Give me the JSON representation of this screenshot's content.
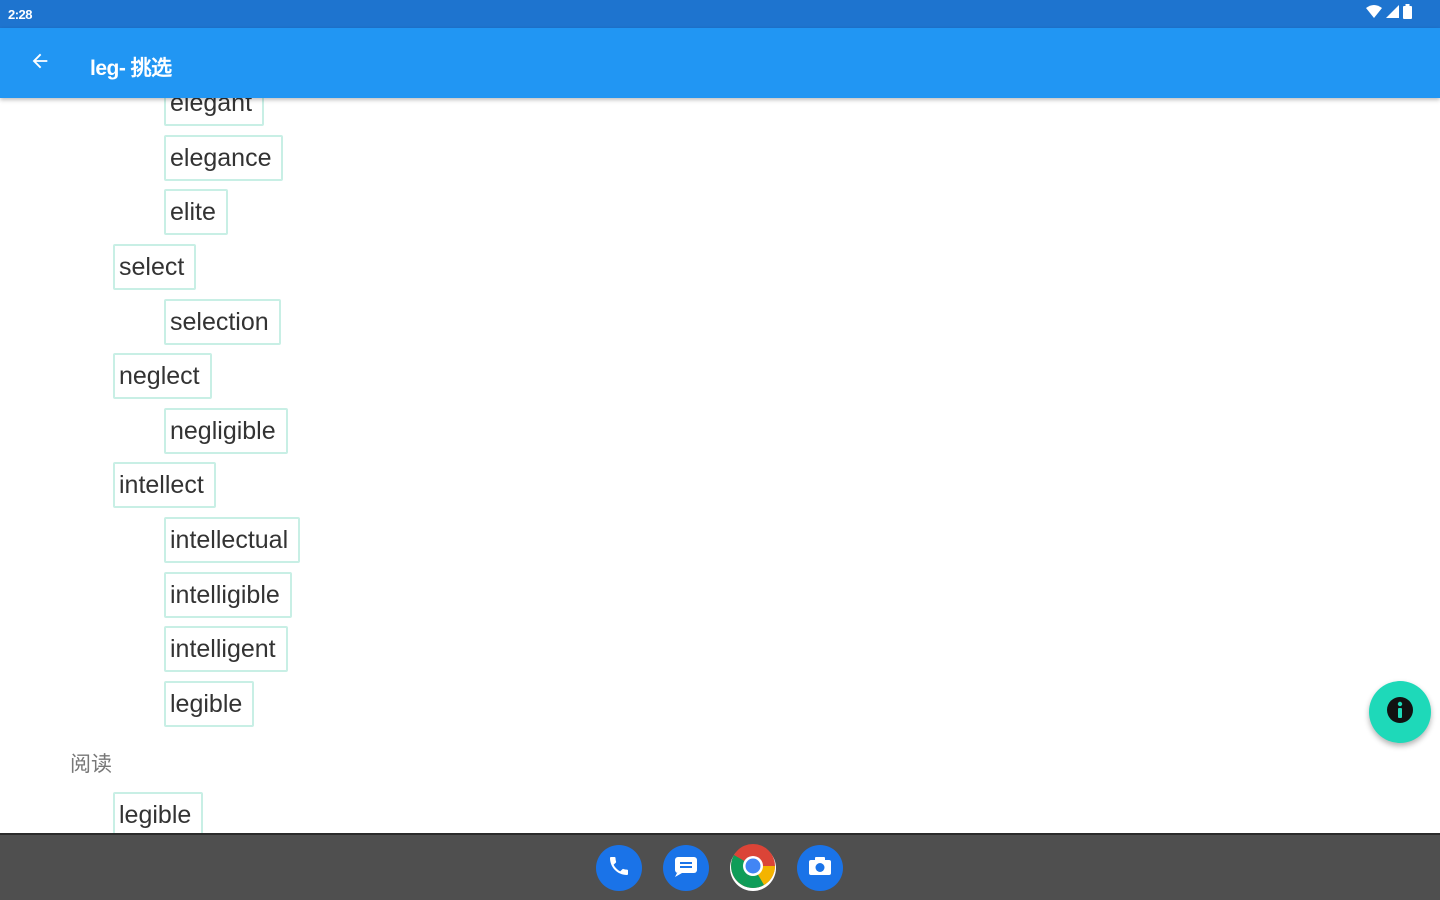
{
  "status_bar": {
    "time": "2:28",
    "icons": [
      "wifi-icon",
      "signal-icon",
      "battery-icon"
    ]
  },
  "app_bar": {
    "title": "leg- 挑选",
    "back_icon": "arrow-back-icon"
  },
  "word_tree": [
    {
      "word": "elegant",
      "level": 2
    },
    {
      "word": "elegance",
      "level": 2
    },
    {
      "word": "elite",
      "level": 2
    },
    {
      "word": "select",
      "level": 1
    },
    {
      "word": "selection",
      "level": 2
    },
    {
      "word": "neglect",
      "level": 1
    },
    {
      "word": "negligible",
      "level": 2
    },
    {
      "word": "intellect",
      "level": 1
    },
    {
      "word": "intellectual",
      "level": 2
    },
    {
      "word": "intelligible",
      "level": 2
    },
    {
      "word": "intelligent",
      "level": 2
    },
    {
      "word": "legible",
      "level": 2
    }
  ],
  "reading_section": {
    "label": "阅读",
    "words": [
      "legible"
    ]
  },
  "fab": {
    "icon": "info-icon"
  },
  "dock": {
    "apps": [
      "phone-icon",
      "messages-icon",
      "chrome-icon",
      "camera-icon"
    ]
  },
  "colors": {
    "status_bar": "#1e74cf",
    "app_bar": "#2196f3",
    "chip_border": "#c8efe5",
    "fab": "#1ed9b9",
    "nav_bar": "#4f4f4f"
  }
}
